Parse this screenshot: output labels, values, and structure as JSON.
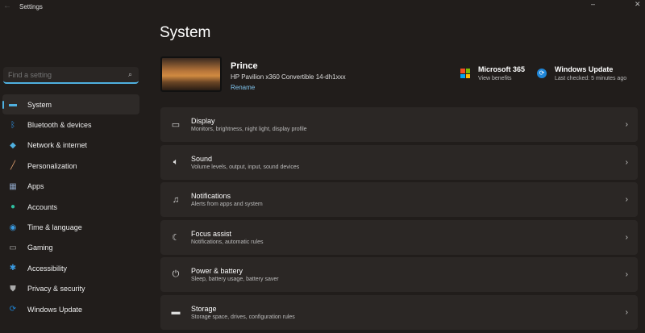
{
  "app": {
    "title": "Settings"
  },
  "search": {
    "placeholder": "Find a setting"
  },
  "nav": [
    {
      "label": "System",
      "icon": "monitor-icon",
      "color": "#4fb0e0"
    },
    {
      "label": "Bluetooth & devices",
      "icon": "bluetooth-icon",
      "color": "#2f8fe0"
    },
    {
      "label": "Network & internet",
      "icon": "wifi-icon",
      "color": "#4fb0e0"
    },
    {
      "label": "Personalization",
      "icon": "brush-icon",
      "color": "#e0a070"
    },
    {
      "label": "Apps",
      "icon": "apps-icon",
      "color": "#8aa0c0"
    },
    {
      "label": "Accounts",
      "icon": "person-icon",
      "color": "#2fc0a0"
    },
    {
      "label": "Time & language",
      "icon": "globe-clock-icon",
      "color": "#3a9ae0"
    },
    {
      "label": "Gaming",
      "icon": "gamepad-icon",
      "color": "#aaaaaa"
    },
    {
      "label": "Accessibility",
      "icon": "accessibility-icon",
      "color": "#3a9ae0"
    },
    {
      "label": "Privacy & security",
      "icon": "shield-icon",
      "color": "#aaaaaa"
    },
    {
      "label": "Windows Update",
      "icon": "update-icon",
      "color": "#1f86d8"
    }
  ],
  "page": {
    "title": "System"
  },
  "device": {
    "name": "Prince",
    "model": "HP Pavilion x360 Convertible 14-dh1xxx",
    "rename": "Rename"
  },
  "quick": {
    "ms365": {
      "title": "Microsoft 365",
      "sub": "View benefits"
    },
    "update": {
      "title": "Windows Update",
      "sub": "Last checked: 5 minutes ago"
    }
  },
  "cards": [
    {
      "title": "Display",
      "sub": "Monitors, brightness, night light, display profile",
      "icon": "laptop-icon"
    },
    {
      "title": "Sound",
      "sub": "Volume levels, output, input, sound devices",
      "icon": "speaker-icon"
    },
    {
      "title": "Notifications",
      "sub": "Alerts from apps and system",
      "icon": "bell-icon"
    },
    {
      "title": "Focus assist",
      "sub": "Notifications, automatic rules",
      "icon": "moon-icon"
    },
    {
      "title": "Power & battery",
      "sub": "Sleep, battery usage, battery saver",
      "icon": "power-icon"
    },
    {
      "title": "Storage",
      "sub": "Storage space, drives, configuration rules",
      "icon": "storage-icon"
    }
  ]
}
